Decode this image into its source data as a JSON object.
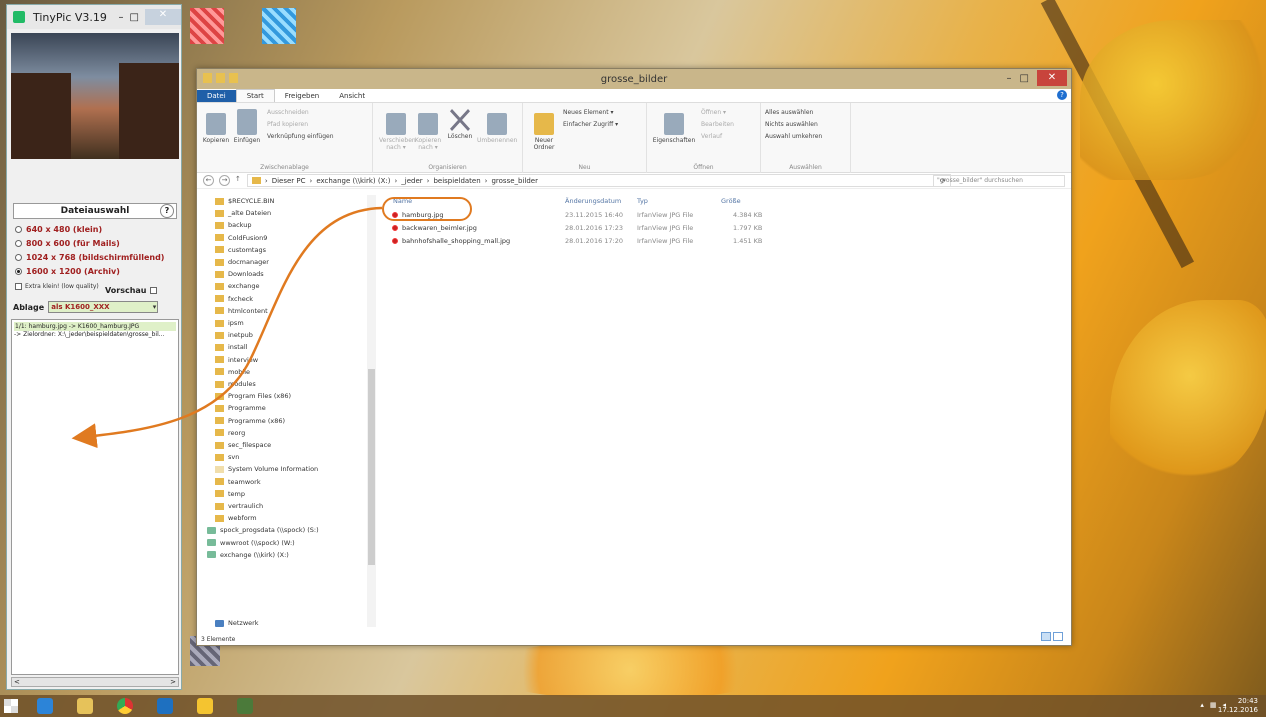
{
  "tinypic": {
    "title": "TinyPic V3.19",
    "min": "–",
    "max": "□",
    "close": "✕",
    "section_title": "Dateiauswahl",
    "help": "?",
    "options": [
      {
        "label": "640 x 480 (klein)",
        "selected": false
      },
      {
        "label": "800 x 600 (für Mails)",
        "selected": false
      },
      {
        "label": "1024 x 768 (bildschirmfüllend)",
        "selected": false
      },
      {
        "label": "1600 x 1200 (Archiv)",
        "selected": true
      }
    ],
    "extra_small": "Extra klein! (low quality)",
    "preview": "Vorschau",
    "ablage_label": "Ablage",
    "ablage_value": "als K1600_XXX",
    "log": [
      "1/1: hamburg.jpg -> K1600_hamburg.JPG",
      "-> Zielordner: X:\\_jeder\\beispieldaten\\grosse_bil..."
    ],
    "scroll_left": "<",
    "scroll_right": ">"
  },
  "explorer": {
    "title": "grosse_bilder",
    "min": "–",
    "max": "□",
    "close": "✕",
    "tabs": [
      "Datei",
      "Start",
      "Freigeben",
      "Ansicht"
    ],
    "ribbon": {
      "clipboard": {
        "caption": "Zwischenablage",
        "copy": "Kopieren",
        "paste": "Einfügen",
        "cut": "Ausschneiden",
        "copy_path": "Pfad kopieren",
        "paste_link": "Verknüpfung einfügen"
      },
      "organize": {
        "caption": "Organisieren",
        "move": "Verschieben nach ▾",
        "copyto": "Kopieren nach ▾",
        "delete": "Löschen",
        "rename": "Umbenennen"
      },
      "new": {
        "caption": "Neu",
        "new_folder": "Neuer Ordner",
        "new_item": "Neues Element ▾",
        "easy_access": "Einfacher Zugriff ▾"
      },
      "open": {
        "caption": "Öffnen",
        "properties": "Eigenschaften",
        "open": "Öffnen ▾",
        "edit": "Bearbeiten",
        "history": "Verlauf"
      },
      "select": {
        "caption": "Auswählen",
        "all": "Alles auswählen",
        "none": "Nichts auswählen",
        "invert": "Auswahl umkehren"
      }
    },
    "path": [
      "Dieser PC",
      "exchange (\\\\kirk) (X:)",
      "_jeder",
      "beispieldaten",
      "grosse_bilder"
    ],
    "search_placeholder": "\"grosse_bilder\" durchsuchen",
    "nav_items": [
      {
        "label": "$RECYCLE.BIN",
        "kind": "folder"
      },
      {
        "label": "_alte Dateien",
        "kind": "folder"
      },
      {
        "label": "backup",
        "kind": "folder"
      },
      {
        "label": "ColdFusion9",
        "kind": "folder"
      },
      {
        "label": "customtags",
        "kind": "folder"
      },
      {
        "label": "docmanager",
        "kind": "folder"
      },
      {
        "label": "Downloads",
        "kind": "folder"
      },
      {
        "label": "exchange",
        "kind": "folder"
      },
      {
        "label": "fxcheck",
        "kind": "folder"
      },
      {
        "label": "htmlcontent",
        "kind": "folder"
      },
      {
        "label": "ipsm",
        "kind": "folder"
      },
      {
        "label": "inetpub",
        "kind": "folder"
      },
      {
        "label": "install",
        "kind": "folder"
      },
      {
        "label": "interview",
        "kind": "folder"
      },
      {
        "label": "mobile",
        "kind": "folder"
      },
      {
        "label": "modules",
        "kind": "folder"
      },
      {
        "label": "Program Files (x86)",
        "kind": "folder"
      },
      {
        "label": "Programme",
        "kind": "folder"
      },
      {
        "label": "Programme (x86)",
        "kind": "folder"
      },
      {
        "label": "reorg",
        "kind": "folder"
      },
      {
        "label": "sec_filespace",
        "kind": "folder"
      },
      {
        "label": "svn",
        "kind": "folder"
      },
      {
        "label": "System Volume Information",
        "kind": "folder-pale"
      },
      {
        "label": "teamwork",
        "kind": "folder"
      },
      {
        "label": "temp",
        "kind": "folder"
      },
      {
        "label": "vertraulich",
        "kind": "folder"
      },
      {
        "label": "webform",
        "kind": "folder"
      },
      {
        "label": "spock_progsdata (\\\\spock) (S:)",
        "kind": "drive"
      },
      {
        "label": "wwwroot (\\\\spock) (W:)",
        "kind": "drive"
      },
      {
        "label": "exchange (\\\\kirk) (X:)",
        "kind": "drive"
      }
    ],
    "network": "Netzwerk",
    "columns": [
      "Name",
      "Änderungsdatum",
      "Typ",
      "Größe"
    ],
    "files": [
      {
        "name": "hamburg.jpg",
        "date": "23.11.2015 16:40",
        "type": "IrfanView JPG File",
        "size": "4.384 KB"
      },
      {
        "name": "backwaren_beimler.jpg",
        "date": "28.01.2016 17:23",
        "type": "IrfanView JPG File",
        "size": "1.797 KB"
      },
      {
        "name": "bahnhofshalle_shopping_mall.jpg",
        "date": "28.01.2016 17:20",
        "type": "IrfanView JPG File",
        "size": "1.451 KB"
      }
    ],
    "status": "3 Elemente"
  },
  "taskbar": {
    "clock_time": "20:43",
    "clock_date": "17.12.2016"
  }
}
